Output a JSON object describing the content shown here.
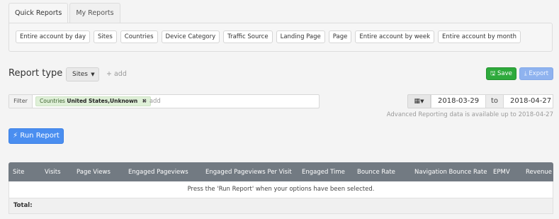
{
  "tabs": [
    {
      "label": "Quick Reports",
      "active": true
    },
    {
      "label": "My Reports",
      "active": false
    }
  ],
  "quick_reports": [
    "Entire account by day",
    "Sites",
    "Countries",
    "Device Category",
    "Traffic Source",
    "Landing Page",
    "Page",
    "Entire account by week",
    "Entire account by month"
  ],
  "report_type": {
    "label": "Report type",
    "arrow": ">",
    "selected": "Sites",
    "add": "+ add"
  },
  "actions": {
    "save_icon": "floppy-icon",
    "save": "Save",
    "export_icon": "download-icon",
    "export": "Export"
  },
  "filter": {
    "label": "Filter",
    "tag_key": "Countries",
    "tag_value": "United States,Unknown",
    "remove": "✖",
    "add": "+ add"
  },
  "dates": {
    "calendar_icon": "calendar-icon",
    "from": "2018-03-29",
    "to_label": "to",
    "to": "2018-04-27",
    "note": "Advanced Reporting data is available up to 2018-04-27"
  },
  "run_report": {
    "icon": "bolt-icon",
    "label": "Run Report"
  },
  "table": {
    "columns": [
      "Site",
      "Visits",
      "Page Views",
      "Engaged Pageviews",
      "Engaged Pageviews Per Visit",
      "Engaged Time",
      "Bounce Rate",
      "Navigation Bounce Rate",
      "EPMV",
      "Revenue"
    ],
    "empty_message": "Press the 'Run Report' when your options have been selected.",
    "total_label": "Total:"
  },
  "colors": {
    "save_green": "#2eaa3c",
    "export_blue": "#8fb3ef",
    "run_blue": "#4a8ef0",
    "table_header": "#727a82",
    "filter_tag": "#dff0d8"
  }
}
